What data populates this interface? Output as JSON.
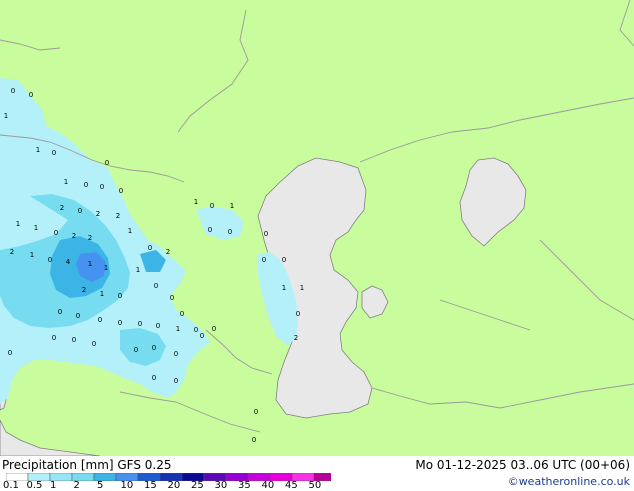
{
  "map": {
    "land_color": "#c8fc9c",
    "water_color": "#e8e8e8",
    "border_color": "#9a9a9a",
    "coast_color": "#808080",
    "precip_light": "#b4f0fa",
    "precip_mid": "#78dcf0",
    "precip_strong": "#3cb4e6",
    "precip_heavy": "#4692f0",
    "value_labels": [
      "0",
      "0",
      "1",
      "1",
      "0",
      "0",
      "0",
      "1",
      "1",
      "0",
      "0",
      "2",
      "0",
      "2",
      "2",
      "1",
      "1",
      "0",
      "2",
      "2",
      "1",
      "0",
      "2",
      "2",
      "1",
      "0",
      "4",
      "1",
      "1",
      "2",
      "1",
      "0",
      "0",
      "0",
      "0",
      "0",
      "0",
      "0",
      "1",
      "0",
      "0",
      "0",
      "0",
      "0",
      "0",
      "0",
      "0",
      "0",
      "0",
      "0",
      "0",
      "1",
      "0",
      "0",
      "0",
      "0",
      "0",
      "1",
      "1",
      "0",
      "2",
      "0",
      "0",
      "1",
      "0",
      "0",
      "0",
      "0"
    ]
  },
  "footer": {
    "title": "Precipitation [mm]  GFS 0.25",
    "run_time": "Mo 01-12-2025 03..06 UTC (00+06)",
    "credit": "©weatheronline.co.uk"
  },
  "legend": {
    "ticks": [
      "0.1",
      "0.5",
      "1",
      "2",
      "5",
      "10",
      "15",
      "20",
      "25",
      "30",
      "35",
      "40",
      "45",
      "50"
    ],
    "colors": [
      "#ffffff",
      "#b4f0fa",
      "#96e6fa",
      "#78dcf0",
      "#3cb4e6",
      "#4692f0",
      "#1e5ad2",
      "#1432b4",
      "#0a0a96",
      "#5a0ab4",
      "#9600d2",
      "#c800dc",
      "#e600dc",
      "#fa32e6",
      "#b40096"
    ]
  }
}
